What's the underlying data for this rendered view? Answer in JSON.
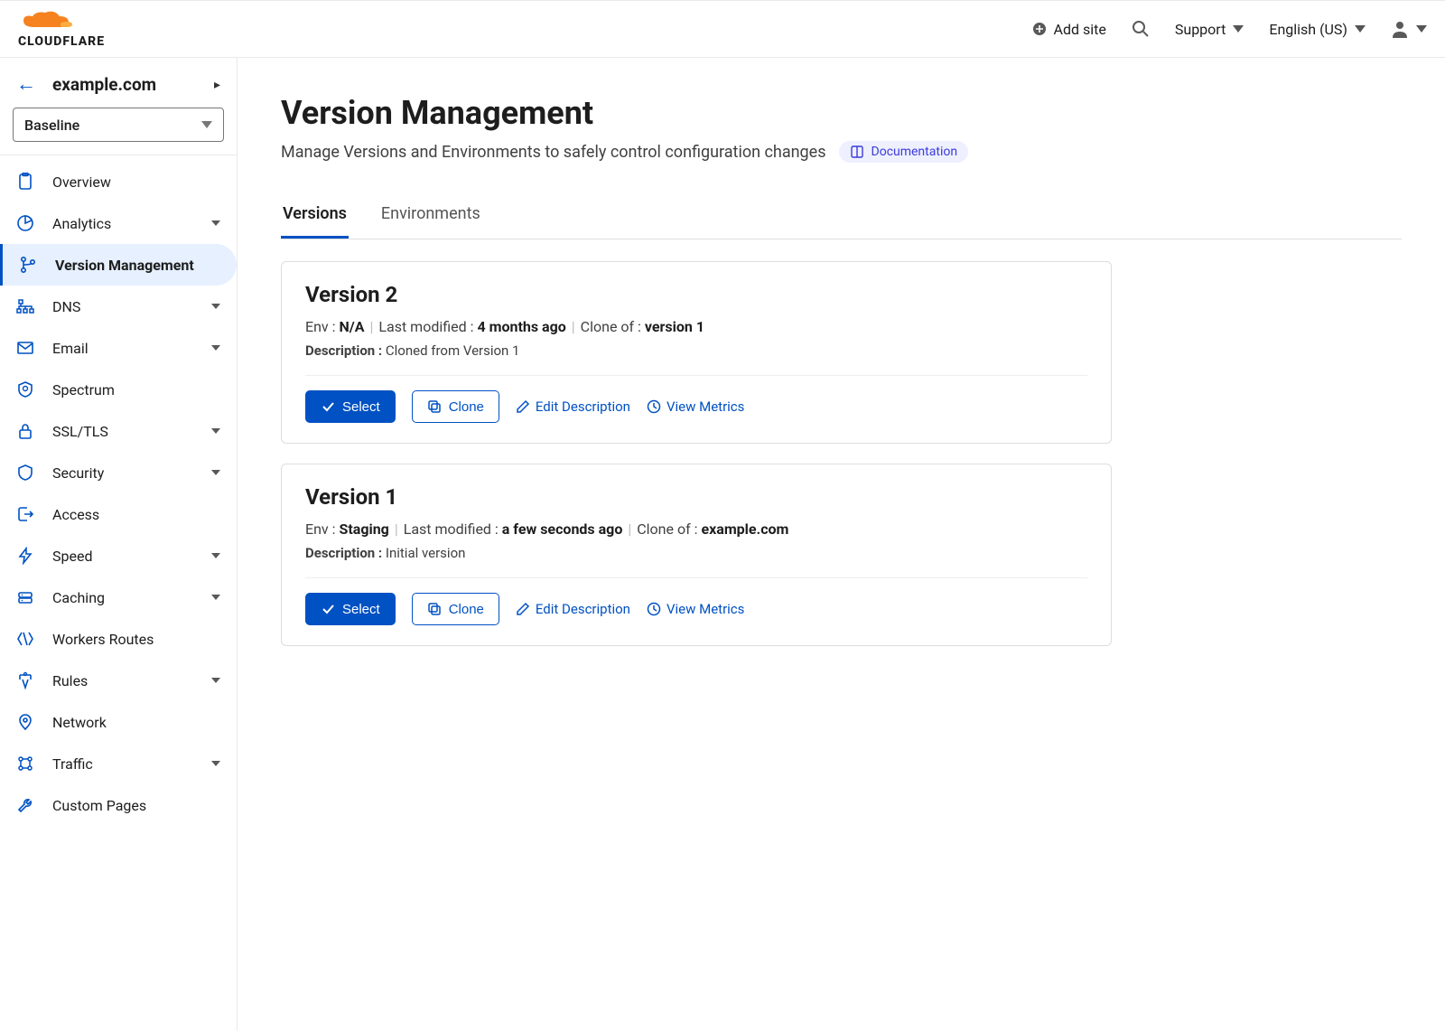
{
  "brand": "CLOUDFLARE",
  "header": {
    "add_site": "Add site",
    "support": "Support",
    "language": "English (US)"
  },
  "sidebar": {
    "site_name": "example.com",
    "version_selector": "Baseline",
    "items": [
      {
        "label": "Overview",
        "icon": "clipboard",
        "expandable": false,
        "active": false
      },
      {
        "label": "Analytics",
        "icon": "pie",
        "expandable": true,
        "active": false
      },
      {
        "label": "Version Management",
        "icon": "branch",
        "expandable": false,
        "active": true
      },
      {
        "label": "DNS",
        "icon": "dns",
        "expandable": true,
        "active": false
      },
      {
        "label": "Email",
        "icon": "mail",
        "expandable": true,
        "active": false
      },
      {
        "label": "Spectrum",
        "icon": "shield-badge",
        "expandable": false,
        "active": false
      },
      {
        "label": "SSL/TLS",
        "icon": "lock",
        "expandable": true,
        "active": false
      },
      {
        "label": "Security",
        "icon": "shield",
        "expandable": true,
        "active": false
      },
      {
        "label": "Access",
        "icon": "logout",
        "expandable": false,
        "active": false
      },
      {
        "label": "Speed",
        "icon": "bolt",
        "expandable": true,
        "active": false
      },
      {
        "label": "Caching",
        "icon": "drive",
        "expandable": true,
        "active": false
      },
      {
        "label": "Workers Routes",
        "icon": "workers",
        "expandable": false,
        "active": false
      },
      {
        "label": "Rules",
        "icon": "rules",
        "expandable": true,
        "active": false
      },
      {
        "label": "Network",
        "icon": "pin",
        "expandable": false,
        "active": false
      },
      {
        "label": "Traffic",
        "icon": "traffic",
        "expandable": true,
        "active": false
      },
      {
        "label": "Custom Pages",
        "icon": "wrench",
        "expandable": false,
        "active": false
      }
    ]
  },
  "page": {
    "title": "Version Management",
    "subtitle": "Manage Versions and Environments to safely control configuration changes",
    "doc_label": "Documentation",
    "tabs": {
      "versions": "Versions",
      "environments": "Environments"
    },
    "meta_labels": {
      "env": "Env :",
      "last_modified": "Last modified :",
      "clone_of": "Clone of :",
      "description": "Description :"
    },
    "actions": {
      "select": "Select",
      "clone": "Clone",
      "edit": "Edit Description",
      "metrics": "View Metrics"
    },
    "versions": [
      {
        "title": "Version 2",
        "env": "N/A",
        "last_modified": "4 months ago",
        "clone_of": "version 1",
        "description": "Cloned from Version 1"
      },
      {
        "title": "Version 1",
        "env": "Staging",
        "last_modified": "a few seconds ago",
        "clone_of": "example.com",
        "description": "Initial version"
      }
    ]
  }
}
